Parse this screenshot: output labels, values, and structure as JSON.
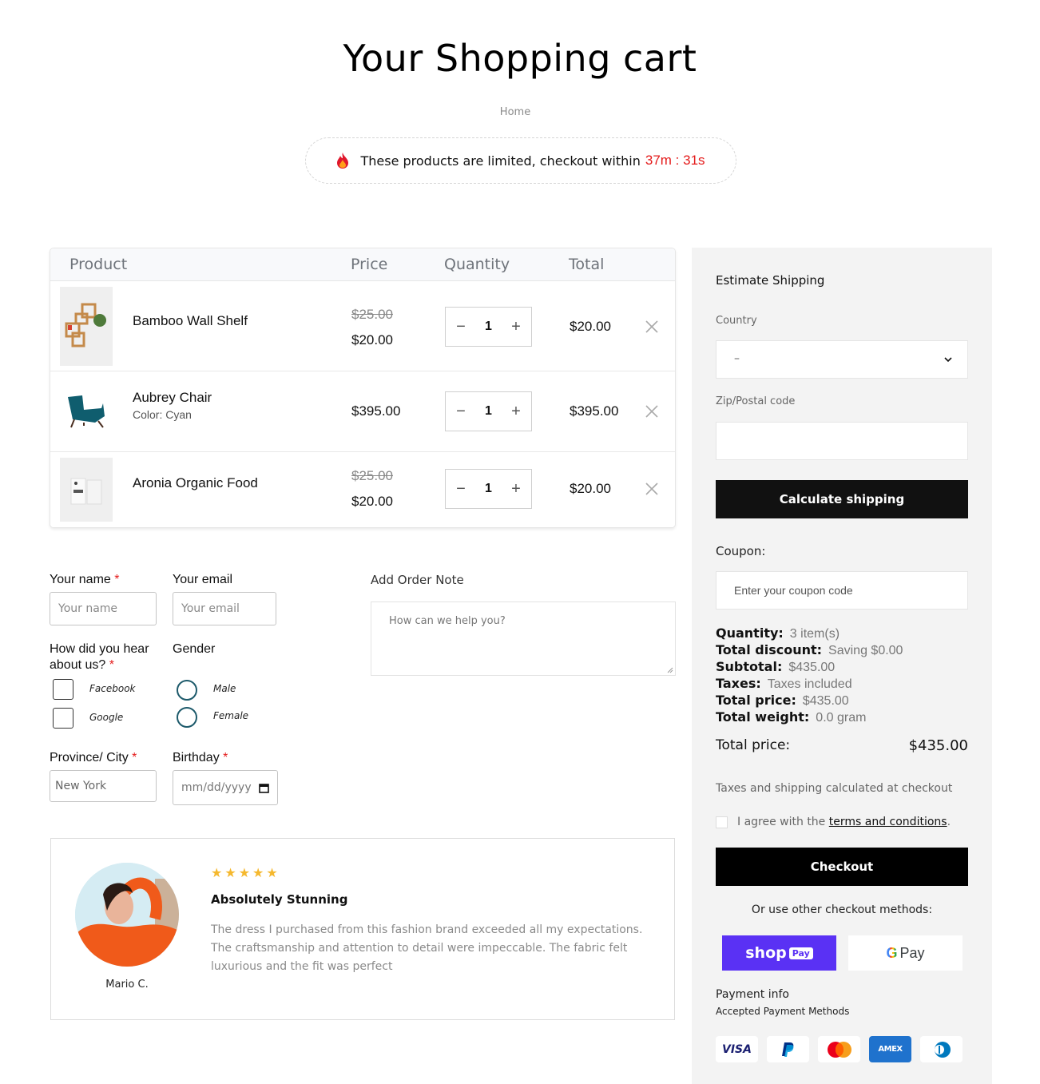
{
  "page": {
    "title": "Your Shopping cart",
    "breadcrumb": "Home"
  },
  "timer": {
    "icon": "fire-icon",
    "message": "These products are limited, checkout within",
    "countdown": "37m : 31s",
    "accent_color": "#e41b1b"
  },
  "cart": {
    "headers": [
      "Product",
      "Price",
      "Quantity",
      "Total"
    ],
    "items": [
      {
        "name": "Bamboo Wall Shelf",
        "variant": "",
        "price_old": "$25.00",
        "price": "$20.00",
        "quantity": "1",
        "total": "$20.00"
      },
      {
        "name": "Aubrey Chair",
        "variant": "Color: Cyan",
        "price_old": "",
        "price": "$395.00",
        "quantity": "1",
        "total": "$395.00"
      },
      {
        "name": "Aronia Organic Food",
        "variant": "",
        "price_old": "$25.00",
        "price": "$20.00",
        "quantity": "1",
        "total": "$20.00"
      }
    ],
    "decrement": "−",
    "increment": "+"
  },
  "form": {
    "name_label": "Your name",
    "name_placeholder": "Your name",
    "email_label": "Your email",
    "email_placeholder": "Your email",
    "hear_label": "How did you hear about us?",
    "hear_options": [
      "Facebook",
      "Google"
    ],
    "gender_label": "Gender",
    "gender_options": [
      "Male",
      "Female"
    ],
    "city_label": "Province/ City",
    "city_value": "New York",
    "birthday_label": "Birthday",
    "birthday_placeholder": "mm/dd/yyyy",
    "required_mark": "*"
  },
  "order_note": {
    "label": "Add Order Note",
    "placeholder": "How can we help you?"
  },
  "review": {
    "rating": 5,
    "max_rating": 5,
    "title": "Absolutely Stunning",
    "text": "The dress I purchased from this fashion brand exceeded all my expectations. The craftsmanship and attention to detail were impeccable. The fabric felt luxurious and the fit was perfect",
    "reviewer": "Mario C."
  },
  "sidebar": {
    "shipping_title": "Estimate Shipping",
    "country_label": "Country",
    "country_value": "–",
    "zip_label": "Zip/Postal code",
    "zip_value": "",
    "calculate_label": "Calculate shipping",
    "coupon_label": "Coupon:",
    "coupon_placeholder": "Enter your coupon code",
    "summary": [
      {
        "key": "Quantity:",
        "value": "3 item(s)"
      },
      {
        "key": "Total discount:",
        "value": "Saving $0.00"
      },
      {
        "key": "Subtotal:",
        "value": "$435.00"
      },
      {
        "key": "Taxes:",
        "value": "Taxes included"
      },
      {
        "key": "Total price:",
        "value": "$435.00"
      },
      {
        "key": "Total weight:",
        "value": "0.0 gram"
      }
    ],
    "total_label": "Total price:",
    "total_value": "$435.00",
    "tax_note": "Taxes and shipping calculated at checkout",
    "agree_prefix": "I agree with the",
    "agree_link": "terms and conditions",
    "agree_suffix": ".",
    "checkout_label": "Checkout",
    "other_methods": "Or use other checkout methods:",
    "shoppay_label": "shop",
    "shoppay_tag": "Pay",
    "gpay_g": "G",
    "gpay_label": "Pay",
    "payment_info": "Payment info",
    "accepted_methods": "Accepted Payment Methods",
    "cards": [
      "VISA",
      "PayPal",
      "Mastercard",
      "AMEX",
      "Diners Club"
    ],
    "amex_label": "AMEX",
    "visa_label": "VISA"
  }
}
